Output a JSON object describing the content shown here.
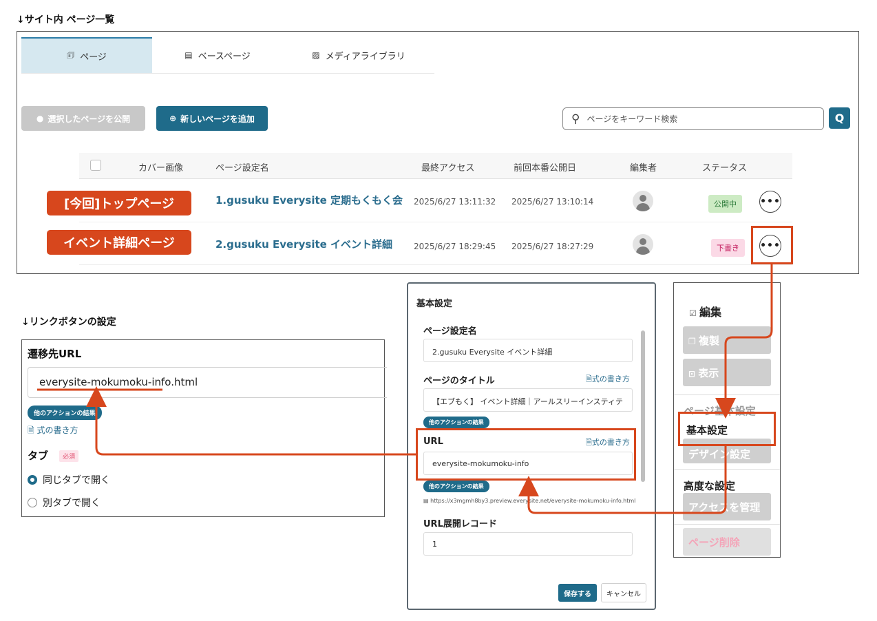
{
  "headings": {
    "page_list": "↓サイト内 ページ一覧",
    "link_settings": "↓リンクボタンの設定"
  },
  "tabs": [
    {
      "icon": "page-icon",
      "glyph": "🗊",
      "label": "ページ"
    },
    {
      "icon": "base-page-icon",
      "glyph": "▤",
      "label": "ベースページ"
    },
    {
      "icon": "image-icon",
      "glyph": "▨",
      "label": "メディアライブラリ"
    }
  ],
  "toolbar": {
    "publish_selected": "選択したページを公開",
    "add_page": "新しいページを追加",
    "search_placeholder": "ページをキーワード検索",
    "search_button": "Q"
  },
  "table": {
    "columns": [
      "カバー画像",
      "ページ設定名",
      "最終アクセス",
      "前回本番公開日",
      "編集者",
      "ステータス"
    ],
    "rows": [
      {
        "callout": "[今回]トップページ",
        "name": "1.gusuku Everysite 定期もくもく会",
        "last_access": "2025/6/27 13:11:32",
        "last_published": "2025/6/27 13:10:14",
        "status": "公開中",
        "status_color": "#cdebc4",
        "more": "•••"
      },
      {
        "callout": "イベント詳細ページ",
        "name": "2.gusuku Everysite イベント詳細",
        "last_access": "2025/6/27 18:29:45",
        "last_published": "2025/6/27 18:27:29",
        "status": "下書き",
        "status_color": "#fbd9e6",
        "more": "•••"
      }
    ]
  },
  "link_panel": {
    "title": "遷移先URL",
    "url_value": "everysite-mokumoku-info.html",
    "chip": "他のアクションの結果",
    "formula_link": "式の書き方",
    "tab_label": "タブ",
    "required": "必須",
    "options": [
      "同じタブで開く",
      "別タブで開く"
    ],
    "selected_option": "同じタブで開く"
  },
  "modal": {
    "title": "基本設定",
    "page_setting_name_label": "ページ設定名",
    "page_setting_name_value": "2.gusuku Everysite イベント詳細",
    "page_title_label": "ページのタイトル",
    "page_title_value": "【エブもく】 イベント詳細｜アールスリーインスティテ",
    "formula_link": "式の書き方",
    "chip": "他のアクションの結果",
    "url_label": "URL",
    "url_value": "everysite-mokumoku-info",
    "url_preview": "https://x3mgmh8by3.preview.everysite.net/everysite-mokumoku-info.html",
    "url_record_label": "URL展開レコード",
    "url_record_value": "1",
    "save": "保存する",
    "cancel": "キャンセル"
  },
  "menu": {
    "edit": "編集",
    "duplicate": "複製",
    "view": "表示",
    "section_basic": "ページ基本設定",
    "basic_settings": "基本設定",
    "design_settings": "デザイン設定",
    "section_advanced": "高度な設定",
    "manage_access": "アクセスを管理",
    "delete_page": "ページ削除"
  },
  "colors": {
    "accent": "#1f6b8a",
    "annotation": "#d7471d"
  }
}
